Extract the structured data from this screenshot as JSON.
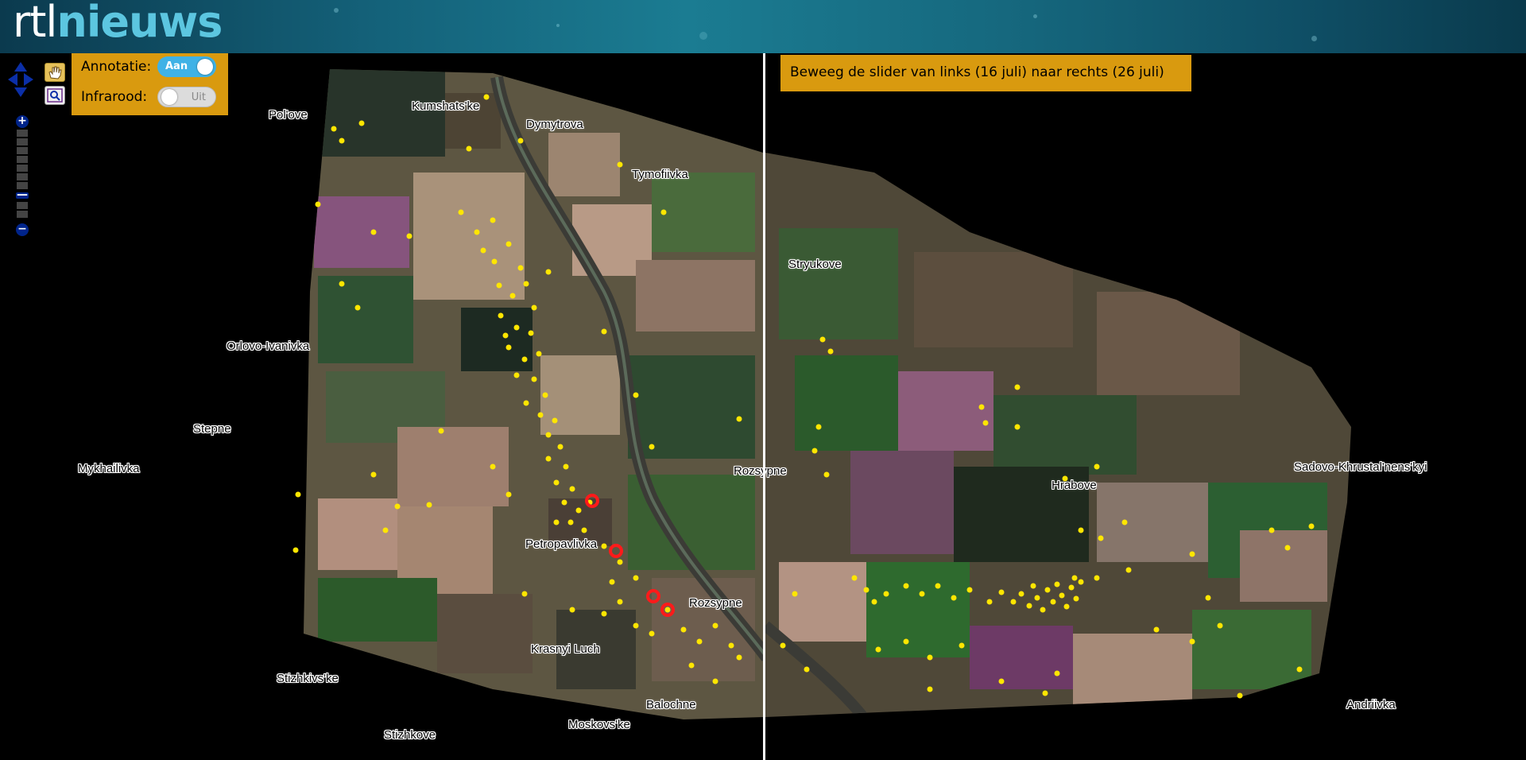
{
  "header": {
    "logo_light": "rtl",
    "logo_bold": "nieuws"
  },
  "controls": {
    "annotatie_label": "Annotatie:",
    "annotatie_state": "Aan",
    "infrarood_label": "Infrarood:",
    "infrarood_state": "Uit"
  },
  "hint": "Beweeg de slider van links (16 juli) naar rechts (26 juli)",
  "places": [
    "Pol'ove",
    "Kumshats'ke",
    "Dymytrova",
    "Tymofiivka",
    "Stryukove",
    "Orlovo-Ivanivka",
    "Stepne",
    "Mykhailivka",
    "Rozsypne",
    "Hrabove",
    "Sadovo-Khrustal'nens'kyi",
    "Petropavlivka",
    "Rozsypne",
    "Krasnyi Luch",
    "Stizhkivs'ke",
    "Balochne",
    "Moskovs'ke",
    "Stizhkove",
    "Andriivka"
  ],
  "colors": {
    "hint_bg": "#d99a0f",
    "toggle_on": "#3fb2e6",
    "marker": "#ffe600",
    "crater": "#ff1a1a",
    "zoom_button": "#00248a"
  },
  "icons": {
    "pan": "pan-arrows-icon",
    "hand": "hand-icon",
    "zoom_box": "zoom-box-icon",
    "zoom_in": "plus-icon",
    "zoom_out": "minus-icon"
  }
}
